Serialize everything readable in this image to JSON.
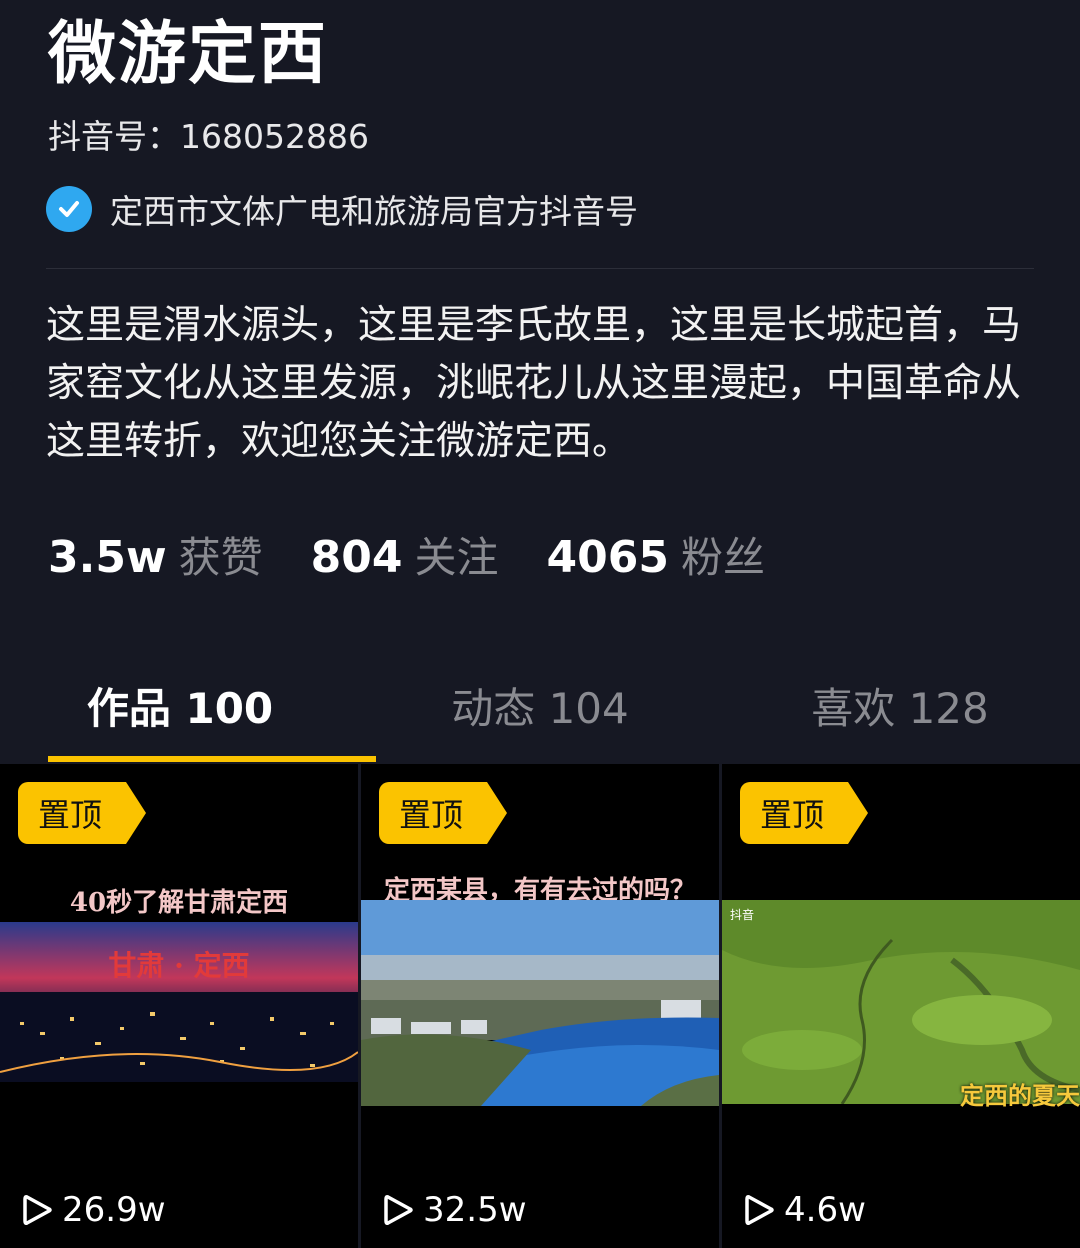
{
  "profile": {
    "name": "微游定西",
    "account_id": "抖音号：168052886",
    "verification": "定西市文体广电和旅游局官方抖音号",
    "bio": "这里是渭水源头，这里是李氏故里，这里是长城起首，马家窑文化从这里发源，洮岷花儿从这里漫起，中国革命从这里转折，欢迎您关注微游定西。"
  },
  "stats": [
    {
      "value": "3.5w",
      "label": "获赞"
    },
    {
      "value": "804",
      "label": "关注"
    },
    {
      "value": "4065",
      "label": "粉丝"
    }
  ],
  "tabs": [
    {
      "label": "作品 100",
      "active": true
    },
    {
      "label": "动态 104",
      "active": false
    },
    {
      "label": "喜欢 128",
      "active": false
    }
  ],
  "videos": [
    {
      "pin": "置顶",
      "caption": "40秒了解甘肃定西",
      "overlay": "甘肃 · 定西",
      "plays": "26.9w"
    },
    {
      "pin": "置顶",
      "caption": "定西某县，有有去过的吗？",
      "plays": "32.5w"
    },
    {
      "pin": "置顶",
      "overlay": "定西的夏天",
      "watermark": "抖音",
      "plays": "4.6w"
    }
  ],
  "colors": {
    "background": "#161823",
    "accent": "#fbc300",
    "verify": "#2fa8f0",
    "muted": "#8a8b91"
  },
  "icons": {
    "verify": "check-circle-icon",
    "play": "play-icon"
  }
}
